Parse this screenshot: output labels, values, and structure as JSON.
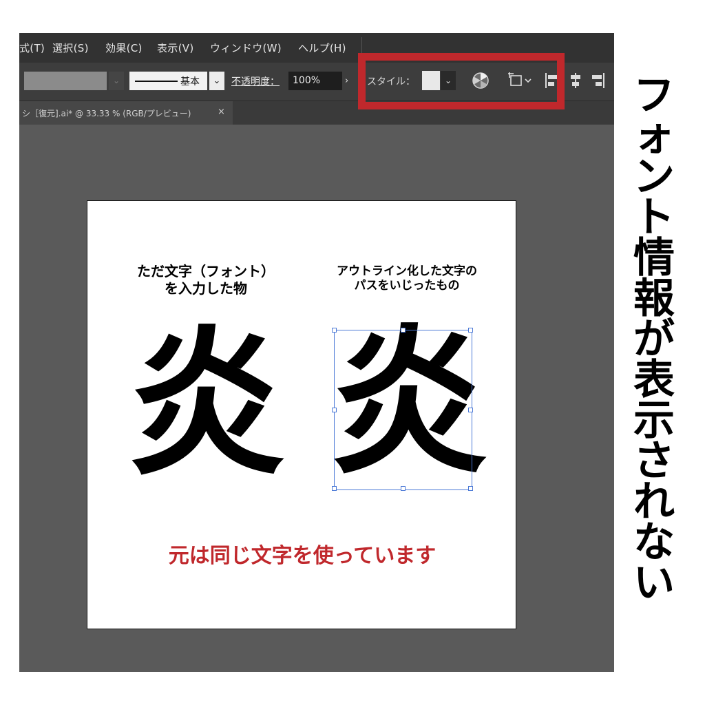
{
  "menu": {
    "items": [
      "式(T)",
      "選択(S)",
      "効果(C)",
      "表示(V)",
      "ウィンドウ(W)",
      "ヘルプ(H)"
    ]
  },
  "control_bar": {
    "stroke_label": "基本",
    "opacity_label": "不透明度：",
    "opacity_value": "100%",
    "style_label": "スタイル：",
    "dropdown_glyph": "⌄",
    "arrow_glyph": "›"
  },
  "icons": {
    "recolor": "recolor-artwork-icon",
    "transform": "transform-icon",
    "align_left": "align-left-icon",
    "align_hcenter": "align-horizontal-center-icon",
    "align_right": "align-right-icon",
    "close": "close-icon"
  },
  "document_tab": {
    "title": "シ［復元].ai* @ 33.33 % (RGB/プレビュー)",
    "close": "×"
  },
  "artboard": {
    "caption_left": [
      "ただ文字（フォント）",
      "を入力した物"
    ],
    "caption_right": [
      "アウトライン化した文字の",
      "パスをいじったもの"
    ],
    "glyph_original": "炎",
    "glyph_outlined": "炎",
    "note": "元は同じ文字を使っています"
  },
  "side_title": [
    "フ",
    "ォ",
    "ン",
    "ト",
    "情",
    "報",
    "が",
    "表",
    "示",
    "さ",
    "れ",
    "な",
    "い"
  ],
  "colors": {
    "highlight": "#c0282c",
    "selection": "#4a78d6",
    "menubar": "#323232",
    "toolbar": "#3d3d3d",
    "canvas": "#5a5a5a"
  }
}
